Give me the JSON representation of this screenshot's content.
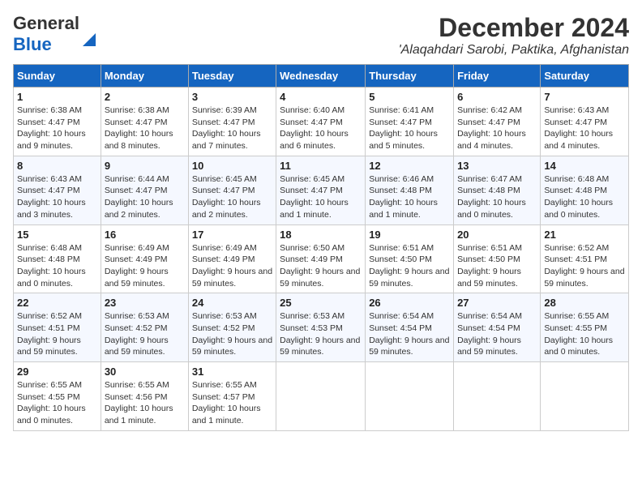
{
  "header": {
    "logo_line1": "General",
    "logo_line2": "Blue",
    "month": "December 2024",
    "location": "'Alaqahdari Sarobi, Paktika, Afghanistan"
  },
  "weekdays": [
    "Sunday",
    "Monday",
    "Tuesday",
    "Wednesday",
    "Thursday",
    "Friday",
    "Saturday"
  ],
  "weeks": [
    [
      {
        "day": "1",
        "sunrise": "6:38 AM",
        "sunset": "4:47 PM",
        "daylight": "10 hours and 9 minutes."
      },
      {
        "day": "2",
        "sunrise": "6:38 AM",
        "sunset": "4:47 PM",
        "daylight": "10 hours and 8 minutes."
      },
      {
        "day": "3",
        "sunrise": "6:39 AM",
        "sunset": "4:47 PM",
        "daylight": "10 hours and 7 minutes."
      },
      {
        "day": "4",
        "sunrise": "6:40 AM",
        "sunset": "4:47 PM",
        "daylight": "10 hours and 6 minutes."
      },
      {
        "day": "5",
        "sunrise": "6:41 AM",
        "sunset": "4:47 PM",
        "daylight": "10 hours and 5 minutes."
      },
      {
        "day": "6",
        "sunrise": "6:42 AM",
        "sunset": "4:47 PM",
        "daylight": "10 hours and 4 minutes."
      },
      {
        "day": "7",
        "sunrise": "6:43 AM",
        "sunset": "4:47 PM",
        "daylight": "10 hours and 4 minutes."
      }
    ],
    [
      {
        "day": "8",
        "sunrise": "6:43 AM",
        "sunset": "4:47 PM",
        "daylight": "10 hours and 3 minutes."
      },
      {
        "day": "9",
        "sunrise": "6:44 AM",
        "sunset": "4:47 PM",
        "daylight": "10 hours and 2 minutes."
      },
      {
        "day": "10",
        "sunrise": "6:45 AM",
        "sunset": "4:47 PM",
        "daylight": "10 hours and 2 minutes."
      },
      {
        "day": "11",
        "sunrise": "6:45 AM",
        "sunset": "4:47 PM",
        "daylight": "10 hours and 1 minute."
      },
      {
        "day": "12",
        "sunrise": "6:46 AM",
        "sunset": "4:48 PM",
        "daylight": "10 hours and 1 minute."
      },
      {
        "day": "13",
        "sunrise": "6:47 AM",
        "sunset": "4:48 PM",
        "daylight": "10 hours and 0 minutes."
      },
      {
        "day": "14",
        "sunrise": "6:48 AM",
        "sunset": "4:48 PM",
        "daylight": "10 hours and 0 minutes."
      }
    ],
    [
      {
        "day": "15",
        "sunrise": "6:48 AM",
        "sunset": "4:48 PM",
        "daylight": "10 hours and 0 minutes."
      },
      {
        "day": "16",
        "sunrise": "6:49 AM",
        "sunset": "4:49 PM",
        "daylight": "9 hours and 59 minutes."
      },
      {
        "day": "17",
        "sunrise": "6:49 AM",
        "sunset": "4:49 PM",
        "daylight": "9 hours and 59 minutes."
      },
      {
        "day": "18",
        "sunrise": "6:50 AM",
        "sunset": "4:49 PM",
        "daylight": "9 hours and 59 minutes."
      },
      {
        "day": "19",
        "sunrise": "6:51 AM",
        "sunset": "4:50 PM",
        "daylight": "9 hours and 59 minutes."
      },
      {
        "day": "20",
        "sunrise": "6:51 AM",
        "sunset": "4:50 PM",
        "daylight": "9 hours and 59 minutes."
      },
      {
        "day": "21",
        "sunrise": "6:52 AM",
        "sunset": "4:51 PM",
        "daylight": "9 hours and 59 minutes."
      }
    ],
    [
      {
        "day": "22",
        "sunrise": "6:52 AM",
        "sunset": "4:51 PM",
        "daylight": "9 hours and 59 minutes."
      },
      {
        "day": "23",
        "sunrise": "6:53 AM",
        "sunset": "4:52 PM",
        "daylight": "9 hours and 59 minutes."
      },
      {
        "day": "24",
        "sunrise": "6:53 AM",
        "sunset": "4:52 PM",
        "daylight": "9 hours and 59 minutes."
      },
      {
        "day": "25",
        "sunrise": "6:53 AM",
        "sunset": "4:53 PM",
        "daylight": "9 hours and 59 minutes."
      },
      {
        "day": "26",
        "sunrise": "6:54 AM",
        "sunset": "4:54 PM",
        "daylight": "9 hours and 59 minutes."
      },
      {
        "day": "27",
        "sunrise": "6:54 AM",
        "sunset": "4:54 PM",
        "daylight": "9 hours and 59 minutes."
      },
      {
        "day": "28",
        "sunrise": "6:55 AM",
        "sunset": "4:55 PM",
        "daylight": "10 hours and 0 minutes."
      }
    ],
    [
      {
        "day": "29",
        "sunrise": "6:55 AM",
        "sunset": "4:55 PM",
        "daylight": "10 hours and 0 minutes."
      },
      {
        "day": "30",
        "sunrise": "6:55 AM",
        "sunset": "4:56 PM",
        "daylight": "10 hours and 1 minute."
      },
      {
        "day": "31",
        "sunrise": "6:55 AM",
        "sunset": "4:57 PM",
        "daylight": "10 hours and 1 minute."
      },
      null,
      null,
      null,
      null
    ]
  ],
  "labels": {
    "sunrise": "Sunrise:",
    "sunset": "Sunset:",
    "daylight": "Daylight:"
  }
}
